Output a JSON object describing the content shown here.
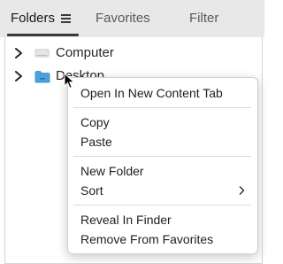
{
  "tabs": [
    {
      "label": "Folders",
      "active": true
    },
    {
      "label": "Favorites",
      "active": false
    },
    {
      "label": "Filter",
      "active": false
    }
  ],
  "icons": {
    "tab_menu": "hamburger-menu-icon",
    "expand": "chevron-right-icon",
    "drive": "drive-icon",
    "folder": "folder-icon",
    "submenu": "chevron-right-icon",
    "pointer": "mouse-pointer-icon"
  },
  "tree": {
    "items": [
      {
        "label": "Computer",
        "icon": "drive-icon"
      },
      {
        "label": "Desktop",
        "icon": "folder-icon"
      }
    ]
  },
  "context_menu": {
    "open_new_tab": "Open In New Content Tab",
    "copy": "Copy",
    "paste": "Paste",
    "new_folder": "New Folder",
    "sort": "Sort",
    "reveal": "Reveal In Finder",
    "remove_favorites": "Remove From Favorites"
  },
  "colors": {
    "tabbar_bg": "#e8e8e8",
    "folder_blue": "#4aa3df",
    "menu_bg": "#ffffff"
  }
}
